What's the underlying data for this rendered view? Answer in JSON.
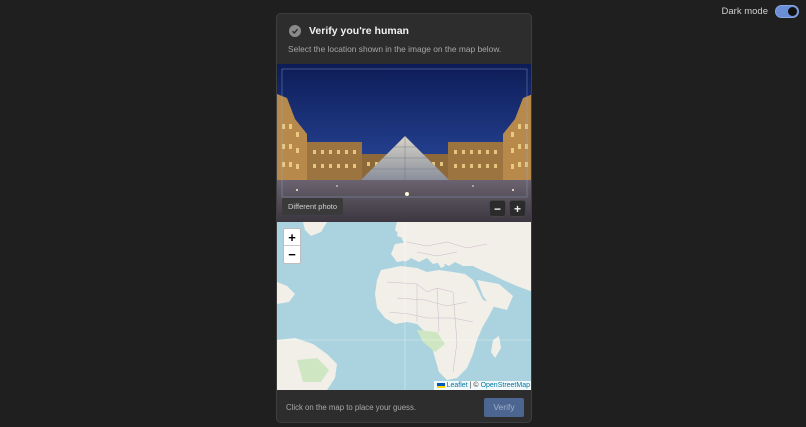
{
  "dark_mode": {
    "label": "Dark mode",
    "enabled": true
  },
  "card": {
    "title": "Verify you're human",
    "subtitle": "Select the location shown in the image on the map below."
  },
  "photo": {
    "different_photo_label": "Different photo",
    "zoom_out_label": "−",
    "zoom_in_label": "+"
  },
  "map": {
    "zoom_in_label": "+",
    "zoom_out_label": "−",
    "attribution": {
      "leaflet": "Leaflet",
      "separator": " | © ",
      "osm": "OpenStreetMap"
    }
  },
  "footer": {
    "hint": "Click on the map to place your guess.",
    "verify_label": "Verify"
  }
}
